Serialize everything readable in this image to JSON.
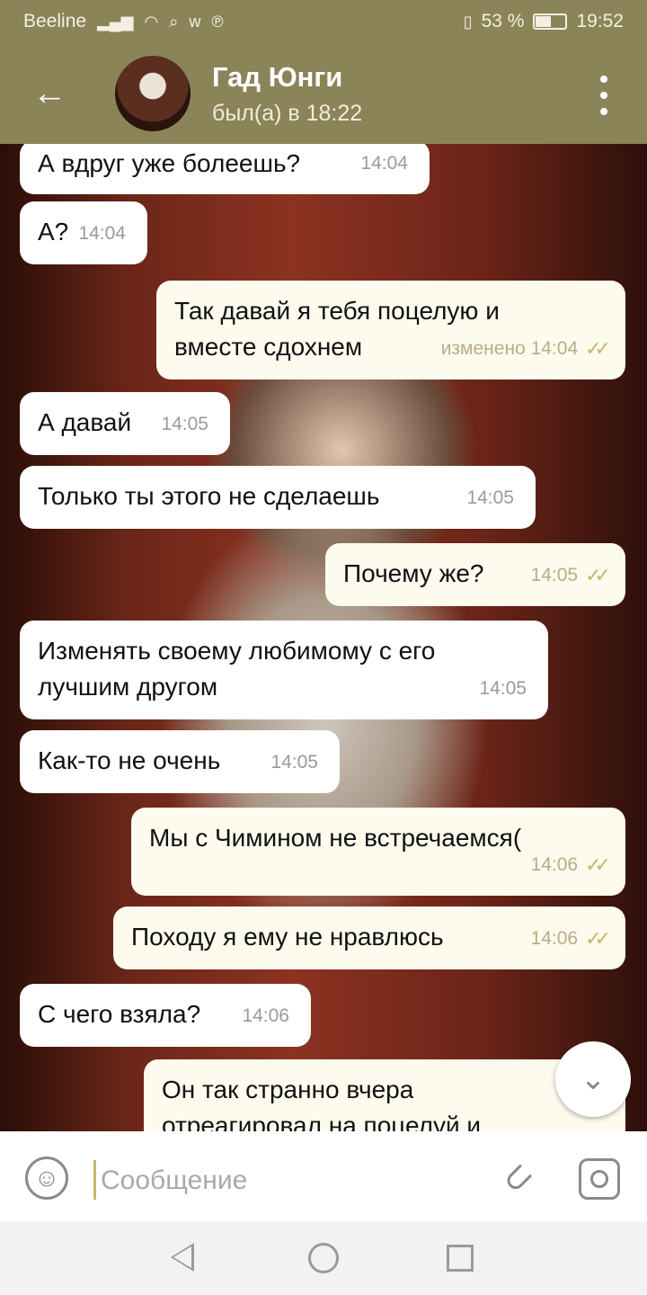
{
  "status_bar": {
    "carrier": "Beeline",
    "signal_icon": "signal-icon",
    "wifi_icon": "wifi-icon",
    "battery_percent": "53 %",
    "battery_level": 0.53,
    "time": "19:52"
  },
  "header": {
    "title": "Гад Юнги",
    "subtitle": "был(а) в 18:22"
  },
  "messages": [
    {
      "dir": "in",
      "text": "А вдруг уже болеешь?",
      "time": "14:04"
    },
    {
      "dir": "in",
      "text": "А?",
      "time": "14:04"
    },
    {
      "dir": "out",
      "text": "Так давай я тебя поцелую и вместе сдохнем",
      "time": "изменено 14:04",
      "read": true
    },
    {
      "dir": "in",
      "text": "А давай",
      "time": "14:05"
    },
    {
      "dir": "in",
      "text": "Только ты этого не сделаешь",
      "time": "14:05"
    },
    {
      "dir": "out",
      "text": "Почему же?",
      "time": "14:05",
      "read": true
    },
    {
      "dir": "in",
      "text": "Изменять своему любимому с его лучшим другом",
      "time": "14:05"
    },
    {
      "dir": "in",
      "text": "Как-то не очень",
      "time": "14:05"
    },
    {
      "dir": "out",
      "text": "Мы с Чимином не встречаемся(",
      "time": "14:06",
      "read": true
    },
    {
      "dir": "out",
      "text": "Походу я ему не нравлюсь",
      "time": "14:06",
      "read": true
    },
    {
      "dir": "in",
      "text": "С чего взяла?",
      "time": "14:06"
    },
    {
      "dir": "out",
      "text": "Он так странно вчера отреагировал на поцелуй и",
      "time": "",
      "read": false
    }
  ],
  "composer": {
    "placeholder": "Сообщение"
  },
  "colors": {
    "header_bg": "#8c8459",
    "out_bubble": "#fdfaee",
    "in_bubble": "#ffffff",
    "tick": "#c8b76b"
  }
}
